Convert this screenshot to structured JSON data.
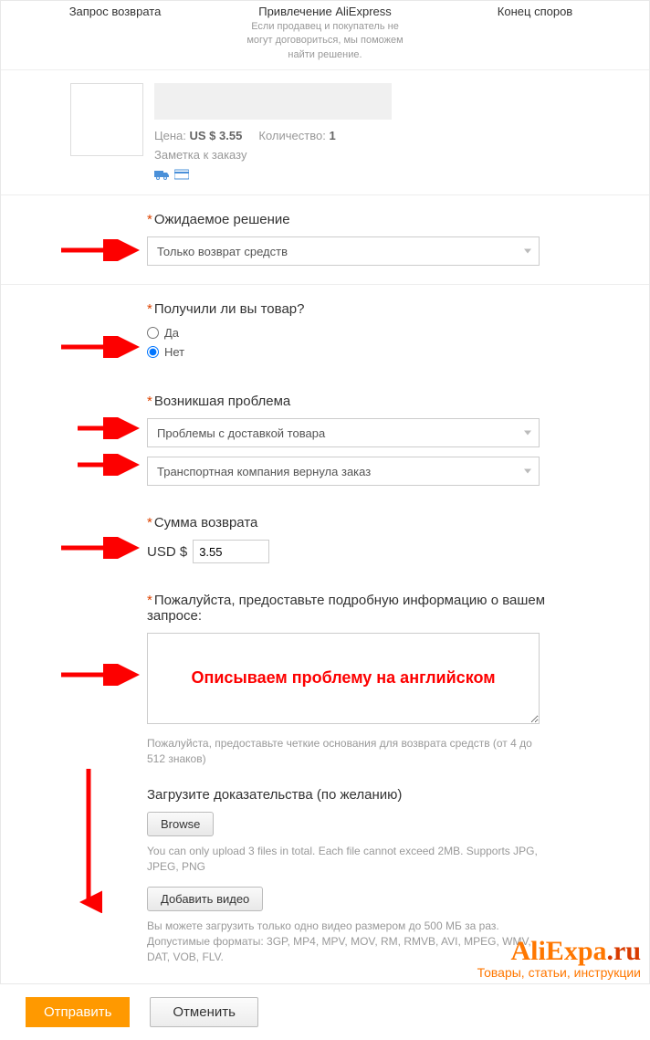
{
  "steps": [
    {
      "title": "Запрос возврата",
      "sub": ""
    },
    {
      "title": "Привлечение AliExpress",
      "sub": "Если продавец и покупатель не могут договориться, мы поможем найти решение."
    },
    {
      "title": "Конец споров",
      "sub": ""
    }
  ],
  "product": {
    "price_label": "Цена:",
    "price_value": "US $ 3.55",
    "qty_label": "Количество:",
    "qty_value": "1",
    "note_label": "Заметка к заказу"
  },
  "form": {
    "expected_label": "Ожидаемое решение",
    "expected_value": "Только возврат средств",
    "received_label": "Получили ли вы товар?",
    "received_yes": "Да",
    "received_no": "Нет",
    "received_selected": "no",
    "problem_label": "Возникшая проблема",
    "problem_value1": "Проблемы с доставкой товара",
    "problem_value2": "Транспортная компания вернула заказ",
    "amount_label": "Сумма возврата",
    "amount_currency": "USD $",
    "amount_value": "3.55",
    "detail_label": "Пожалуйста, предоставьте подробную информацию о вашем запросе:",
    "detail_overlay": "Описываем проблему на английском",
    "detail_hint": "Пожалуйста, предоставьте четкие основания для возврата средств (от 4 до 512 знаков)",
    "evidence_label": "Загрузите доказательства (по желанию)",
    "browse_btn": "Browse",
    "upload_hint": "You can only upload 3 files in total. Each file cannot exceed 2MB. Supports JPG, JPEG, PNG",
    "video_btn": "Добавить видео",
    "video_hint": "Вы можете загрузить только одно видео размером до 500 МБ за раз. Допустимые форматы: 3GP, MP4, MPV, MOV, RM, RMVB, AVI, MPEG, WMV, DAT, VOB, FLV."
  },
  "buttons": {
    "submit": "Отправить",
    "cancel": "Отменить"
  },
  "watermark": {
    "line1a": "AliExpa",
    "line1b": ".ru",
    "line2": "Товары, статьи, инструкции"
  }
}
